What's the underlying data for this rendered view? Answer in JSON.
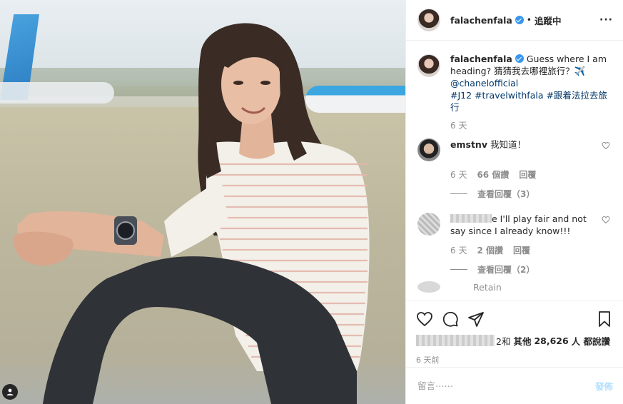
{
  "post": {
    "username": "falachenfala",
    "follow_state": "追蹤中",
    "dot": "•",
    "more": "···"
  },
  "caption": {
    "username": "falachenfala",
    "text_1": " Guess where I am heading? 猜猜我去哪裡旅行？✈️",
    "mention": "@chanelofficial",
    "tags": "#J12 #travelwithfala #跟着法拉去旅行",
    "time": "6 天"
  },
  "comments": [
    {
      "username": "emstnv",
      "text": "我知道！",
      "time": "6 天",
      "likes": "66 個讚",
      "reply_label": "回覆",
      "view_replies": "查看回覆（3）"
    },
    {
      "username": "",
      "text": "e I'll play fair and not say since I already know!!!",
      "time": "6 天",
      "likes": "2 個讚",
      "reply_label": "回覆",
      "view_replies": "查看回覆（2）"
    }
  ],
  "partial_comment": "Retain",
  "likes_line": {
    "suffix": "2和",
    "others_label": "其他",
    "count": "28,626",
    "tail": "人 都說讚"
  },
  "posted_ago": "6 天前",
  "add_comment": {
    "placeholder": "留言⋯⋯",
    "post_label": "發佈"
  },
  "icons": {
    "like": "heart-icon",
    "comment": "comment-icon",
    "share": "share-icon",
    "save": "bookmark-icon",
    "tag": "user-tag-icon"
  },
  "colors": {
    "verified": "#3897f0",
    "link": "#003569",
    "muted": "#8e8e8e",
    "post_disabled": "#b2dffc"
  }
}
